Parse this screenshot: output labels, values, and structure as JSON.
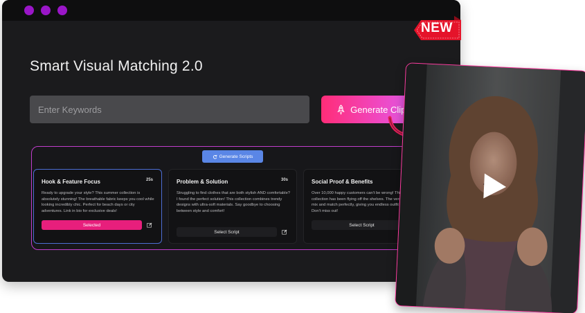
{
  "window": {
    "controls": [
      "dot",
      "dot",
      "dot"
    ]
  },
  "app": {
    "title": "Smart Visual Matching 2.0"
  },
  "search": {
    "placeholder": "Enter Keywords",
    "value": ""
  },
  "actions": {
    "generate_clips": "Generate Clips",
    "generate_scripts": "Generate Scripts"
  },
  "badge": {
    "text": "NEW"
  },
  "cards": [
    {
      "title": "Hook & Feature Focus",
      "duration": "25s",
      "text": "Ready to upgrade your style? This summer collection is absolutely stunning! The breathable fabric keeps you cool while looking incredibly chic. Perfect for beach days or city adventures. Link in bio for exclusive deals!",
      "button": "Selected",
      "selected": true
    },
    {
      "title": "Problem & Solution",
      "duration": "30s",
      "text": "Struggling to find clothes that are both stylish AND comfortable? I found the perfect solution! This collection combines trendy designs with ultra-soft materials. Say goodbye to choosing between style and comfort!",
      "button": "Select Script",
      "selected": false
    },
    {
      "title": "Social Proof & Benefits",
      "duration": "",
      "text": "Over 10,000 happy customers can't be wrong! This summer collection has been flying off the shelves. The versatile pieces mix and match perfectly, giving you endless outfit possibilities. Don't miss out!",
      "button": "Select Script",
      "selected": false
    }
  ],
  "colors": {
    "accent_pink": "#e71f7c",
    "accent_blue": "#5a86e6",
    "window_bg": "#1b1b1d",
    "dots": "#9a16c8",
    "badge_red": "#e5132a"
  },
  "icons": {
    "rocket": "rocket-icon",
    "refresh": "refresh-icon",
    "edit": "edit-icon",
    "play": "play-icon",
    "arrow": "curved-arrow-icon"
  }
}
